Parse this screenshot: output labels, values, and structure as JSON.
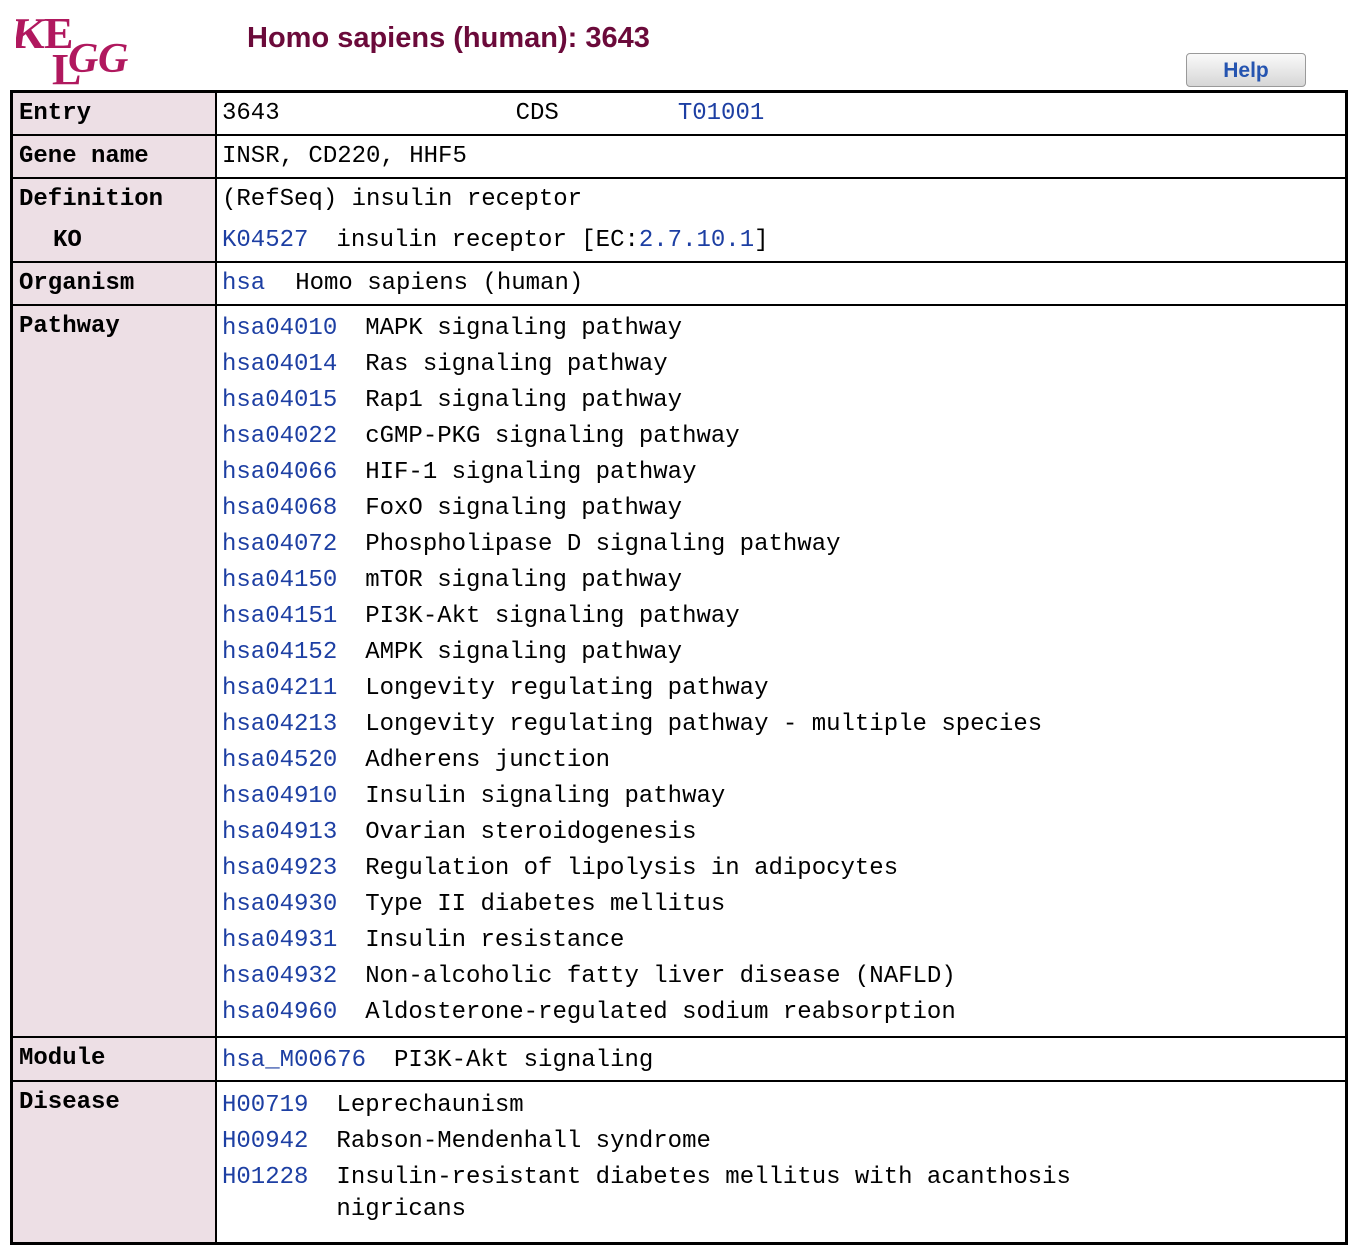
{
  "header": {
    "logo_text": "KEGG",
    "title": "Homo sapiens (human): 3643",
    "help_label": "Help"
  },
  "entry": {
    "label": "Entry",
    "id": "3643",
    "type": "CDS",
    "genome_link": "T01001"
  },
  "gene_name": {
    "label": "Gene name",
    "value": "INSR, CD220, HHF5"
  },
  "definition": {
    "label": "Definition",
    "value": "(RefSeq) insulin receptor",
    "ko_label": "KO",
    "ko_id": "K04527",
    "ko_text": "insulin receptor [EC:",
    "ec_link": "2.7.10.1",
    "ko_close": "]"
  },
  "organism": {
    "label": "Organism",
    "code": "hsa",
    "name": "Homo sapiens (human)"
  },
  "pathway": {
    "label": "Pathway",
    "items": [
      {
        "id": "hsa04010",
        "name": "MAPK signaling pathway"
      },
      {
        "id": "hsa04014",
        "name": "Ras signaling pathway"
      },
      {
        "id": "hsa04015",
        "name": "Rap1 signaling pathway"
      },
      {
        "id": "hsa04022",
        "name": "cGMP-PKG signaling pathway"
      },
      {
        "id": "hsa04066",
        "name": "HIF-1 signaling pathway"
      },
      {
        "id": "hsa04068",
        "name": "FoxO signaling pathway"
      },
      {
        "id": "hsa04072",
        "name": "Phospholipase D signaling pathway"
      },
      {
        "id": "hsa04150",
        "name": "mTOR signaling pathway"
      },
      {
        "id": "hsa04151",
        "name": "PI3K-Akt signaling pathway"
      },
      {
        "id": "hsa04152",
        "name": "AMPK signaling pathway"
      },
      {
        "id": "hsa04211",
        "name": "Longevity regulating pathway"
      },
      {
        "id": "hsa04213",
        "name": "Longevity regulating pathway - multiple species"
      },
      {
        "id": "hsa04520",
        "name": "Adherens junction"
      },
      {
        "id": "hsa04910",
        "name": "Insulin signaling pathway"
      },
      {
        "id": "hsa04913",
        "name": "Ovarian steroidogenesis"
      },
      {
        "id": "hsa04923",
        "name": "Regulation of lipolysis in adipocytes"
      },
      {
        "id": "hsa04930",
        "name": "Type II diabetes mellitus"
      },
      {
        "id": "hsa04931",
        "name": "Insulin resistance"
      },
      {
        "id": "hsa04932",
        "name": "Non-alcoholic fatty liver disease (NAFLD)"
      },
      {
        "id": "hsa04960",
        "name": "Aldosterone-regulated sodium reabsorption"
      }
    ]
  },
  "module": {
    "label": "Module",
    "id": "hsa_M00676",
    "name": "PI3K-Akt signaling"
  },
  "disease": {
    "label": "Disease",
    "items": [
      {
        "id": "H00719",
        "name": "Leprechaunism"
      },
      {
        "id": "H00942",
        "name": "Rabson-Mendenhall syndrome"
      },
      {
        "id": "H01228",
        "name": "Insulin-resistant diabetes mellitus with acanthosis",
        "name_cont": "nigricans"
      }
    ]
  },
  "colors": {
    "title": "#6b0a3a",
    "label_bg": "#eddfe5",
    "link": "#1d3fa3",
    "logo": "#b0185e"
  }
}
